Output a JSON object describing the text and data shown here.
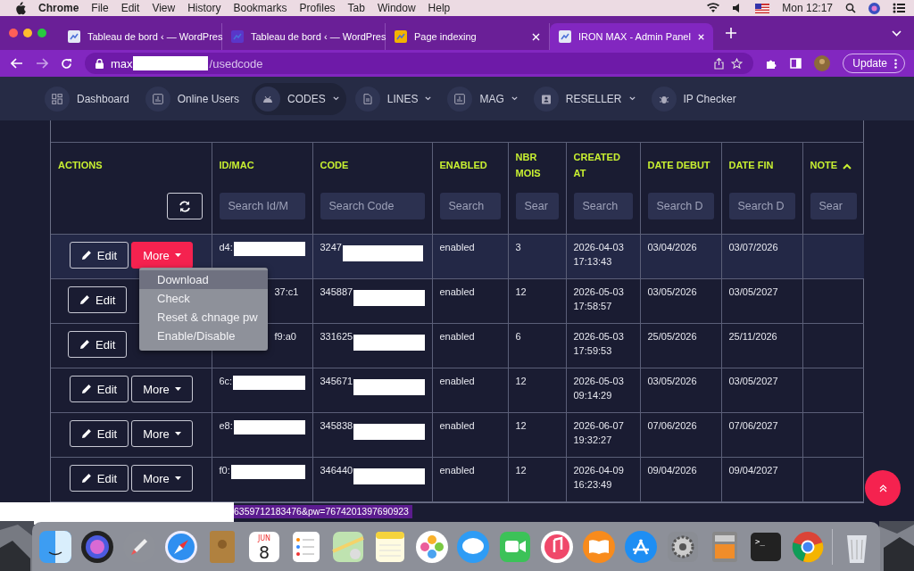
{
  "menubar": {
    "app": "Chrome",
    "menus": [
      "File",
      "Edit",
      "View",
      "History",
      "Bookmarks",
      "Profiles",
      "Tab",
      "Window",
      "Help"
    ],
    "clock": "Mon 12:17"
  },
  "browser": {
    "tabs": [
      {
        "title": "Tableau de bord ‹ — WordPres",
        "selected": false
      },
      {
        "title": "Tableau de bord ‹ — WordPres",
        "selected": false
      },
      {
        "title": "Page indexing",
        "selected": false
      },
      {
        "title": "IRON MAX - Admin Panel",
        "selected": true
      }
    ],
    "url_start": "max",
    "url_end": "/usedcode",
    "update_button": "Update"
  },
  "nav": [
    {
      "label": "Dashboard",
      "dropdown": false,
      "selected": false
    },
    {
      "label": "Online Users",
      "dropdown": false,
      "selected": false
    },
    {
      "label": "CODES",
      "dropdown": true,
      "selected": true
    },
    {
      "label": "LINES",
      "dropdown": true,
      "selected": false
    },
    {
      "label": "MAG",
      "dropdown": true,
      "selected": false
    },
    {
      "label": "RESELLER",
      "dropdown": true,
      "selected": false
    },
    {
      "label": "IP Checker",
      "dropdown": false,
      "selected": false
    }
  ],
  "table": {
    "columns": [
      {
        "label": "ACTIONS"
      },
      {
        "label": "ID/MAC",
        "placeholder": "Search Id/M"
      },
      {
        "label": "CODE",
        "placeholder": "Search Code"
      },
      {
        "label": "ENABLED",
        "placeholder": "Search"
      },
      {
        "label": "NBR MOIS",
        "placeholder": "Sear"
      },
      {
        "label": "CREATED AT",
        "placeholder": "Search"
      },
      {
        "label": "DATE DEBUT",
        "placeholder": "Search D"
      },
      {
        "label": "DATE FIN",
        "placeholder": "Search D"
      },
      {
        "label": "NOTE",
        "placeholder": "Sear",
        "sorted": true
      }
    ],
    "rows": [
      {
        "edit_label": "Edit",
        "more_label": "More",
        "selected": true,
        "more_open": true,
        "id_head": "d4:",
        "code": "3247",
        "enabled": "enabled",
        "nbr_mois": "3",
        "created_date": "2026-04-03",
        "created_time": "17:13:43",
        "date_debut": "03/04/2026",
        "date_fin": "03/07/2026"
      },
      {
        "edit_label": "Edit",
        "selected": false,
        "id_tail": "37:c1",
        "code": "345887",
        "enabled": "enabled",
        "nbr_mois": "12",
        "created_date": "2026-05-03",
        "created_time": "17:58:57",
        "date_debut": "03/05/2026",
        "date_fin": "03/05/2027"
      },
      {
        "edit_label": "Edit",
        "selected": false,
        "id_tail": "f9:a0",
        "code": "331625",
        "enabled": "enabled",
        "nbr_mois": "6",
        "created_date": "2026-05-03",
        "created_time": "17:59:53",
        "date_debut": "25/05/2026",
        "date_fin": "25/11/2026"
      },
      {
        "edit_label": "Edit",
        "more_label": "More",
        "selected": false,
        "more_open": false,
        "id_head": "6c:",
        "code": "345671",
        "enabled": "enabled",
        "nbr_mois": "12",
        "created_date": "2026-05-03",
        "created_time": "09:14:29",
        "date_debut": "03/05/2026",
        "date_fin": "03/05/2027"
      },
      {
        "edit_label": "Edit",
        "more_label": "More",
        "selected": false,
        "more_open": false,
        "id_head": "e8:",
        "code": "345838",
        "enabled": "enabled",
        "nbr_mois": "12",
        "created_date": "2026-06-07",
        "created_time": "19:32:27",
        "date_debut": "07/06/2026",
        "date_fin": "07/06/2027"
      },
      {
        "edit_label": "Edit",
        "more_label": "More",
        "selected": false,
        "more_open": false,
        "id_head": "f0:",
        "code": "346440",
        "enabled": "enabled",
        "nbr_mois": "12",
        "created_date": "2026-04-09",
        "created_time": "16:23:49",
        "date_debut": "09/04/2026",
        "date_fin": "09/04/2027"
      }
    ]
  },
  "more_menu": [
    {
      "label": "Download",
      "selected": true
    },
    {
      "label": "Check",
      "selected": false
    },
    {
      "label": "Reset & chnage pw",
      "selected": false
    },
    {
      "label": "Enable/Disable",
      "selected": false
    }
  ],
  "status_url": "6359712183476&pw=7674201397690923",
  "dock": {
    "calendar_month": "JUN",
    "calendar_day": "8",
    "terminal_prompt": ">_"
  }
}
